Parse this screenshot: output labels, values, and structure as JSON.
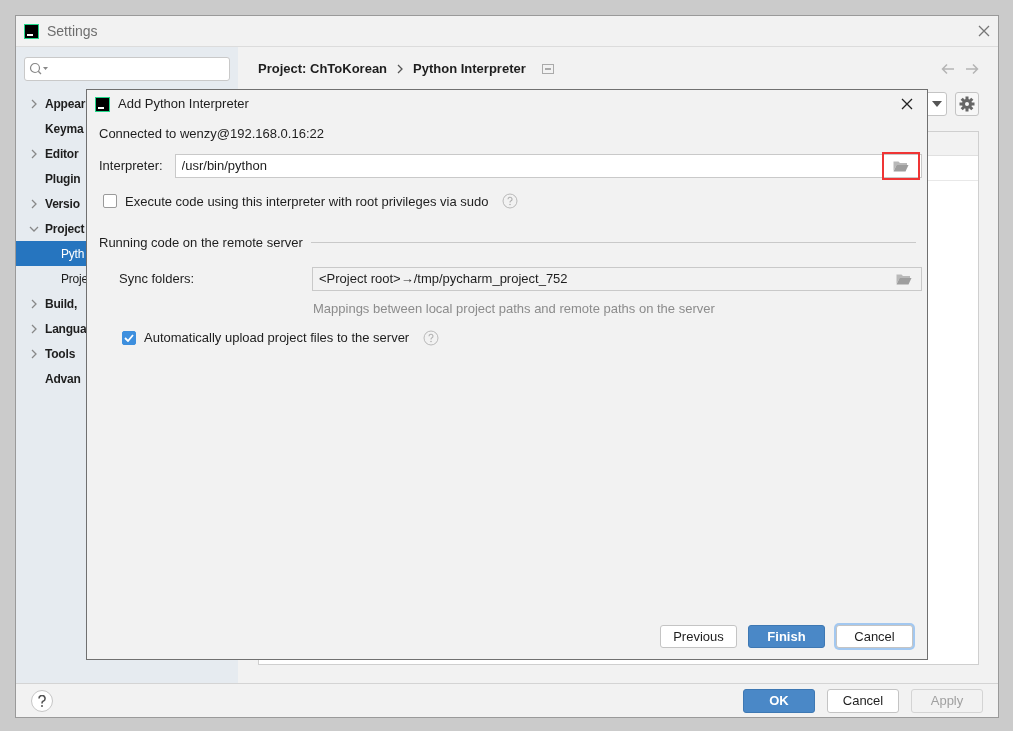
{
  "window": {
    "title": "Settings"
  },
  "sidebar": {
    "items": [
      {
        "label": "Appear",
        "expanded": false,
        "selected": false
      },
      {
        "label": "Keyma",
        "selected": false
      },
      {
        "label": "Editor",
        "expanded": false,
        "selected": false
      },
      {
        "label": "Plugin",
        "selected": false
      },
      {
        "label": "Versio",
        "expanded": false,
        "selected": false
      },
      {
        "label": "Project",
        "expanded": true,
        "selected": false,
        "children": [
          {
            "label": "Pyth",
            "selected": true
          },
          {
            "label": "Proje",
            "selected": false
          }
        ]
      },
      {
        "label": "Build,",
        "expanded": false,
        "selected": false
      },
      {
        "label": "Langua",
        "expanded": false,
        "selected": false
      },
      {
        "label": "Tools",
        "expanded": false,
        "selected": false
      },
      {
        "label": "Advan",
        "selected": false
      }
    ]
  },
  "breadcrumb": [
    "Project: ChToKorean",
    "Python Interpreter"
  ],
  "footer": {
    "buttons": [
      {
        "label": "OK",
        "kind": "primary",
        "disabled": false
      },
      {
        "label": "Cancel",
        "kind": "default",
        "disabled": false
      },
      {
        "label": "Apply",
        "kind": "default",
        "disabled": true
      }
    ]
  },
  "dialog": {
    "title": "Add Python Interpreter",
    "connection": "Connected to wenzy@192.168.0.16:22",
    "interpreter": {
      "label": "Interpreter:",
      "value": "/usr/bin/python",
      "browse_highlighted": true
    },
    "sudo": {
      "label": "Execute code using this interpreter with root privileges via sudo",
      "checked": false
    },
    "section": "Running code on the remote server",
    "sync": {
      "label": "Sync folders:",
      "value": "<Project root>→/tmp/pycharm_project_752",
      "hint": "Mappings between local project paths and remote paths on the server"
    },
    "upload": {
      "label": "Automatically upload project files to the server",
      "checked": true
    },
    "buttons": [
      {
        "label": "Previous",
        "kind": "default",
        "focused": false
      },
      {
        "label": "Finish",
        "kind": "primary",
        "focused": false
      },
      {
        "label": "Cancel",
        "kind": "default",
        "focused": true
      }
    ]
  }
}
